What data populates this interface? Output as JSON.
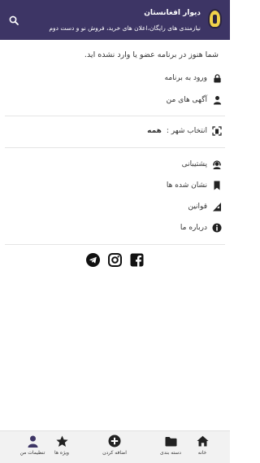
{
  "header": {
    "title": "دیوار افغانستان",
    "subtitle": "نیازمندی های رایگان،اعلان های خرید، فروش نو و دست دوم",
    "background_color": "#3d3565"
  },
  "notice": "شما هنوز در برنامه عضو یا وارد نشده اید.",
  "menu": {
    "login": "ورود به برنامه",
    "my_ads": "آگهی های من",
    "city_label": "انتخاب شهر :",
    "city_value": "همه",
    "support": "پشتیبانی",
    "bookmarks": "نشان شده ها",
    "rules": "قوانین",
    "about": "درباره ما"
  },
  "social": [
    "facebook-icon",
    "instagram-icon",
    "telegram-icon"
  ],
  "bottom_nav": {
    "home": "خانه",
    "categories": "دسته بندی",
    "add": "اضافه کردن",
    "featured": "ویژه ها",
    "settings": "تنظیمات من"
  }
}
